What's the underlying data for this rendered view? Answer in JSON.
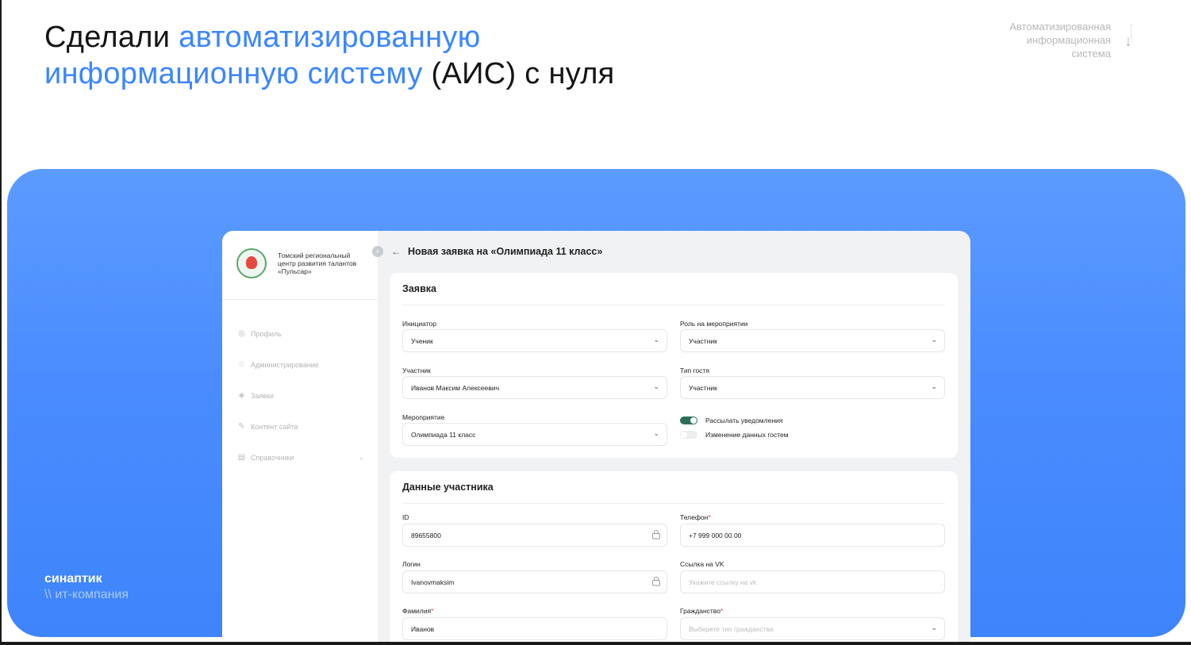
{
  "slide": {
    "headline_part1": "Сделали ",
    "headline_blue1": "автоматизированную",
    "headline_blue2": "информационную систему",
    "headline_part2": " (АИС) с нуля",
    "corner_line1": "Автоматизированная",
    "corner_line2": "информационная",
    "corner_line3": "система",
    "corner_arrow_icon": "arrow-down-icon"
  },
  "brand": {
    "name": "синаптик",
    "tagline": "\\\\ ит-компания"
  },
  "colors": {
    "accent": "#3a86ff",
    "panel": "#4a8cff",
    "toggle_on": "#2b6f57",
    "required": "#e23b3b"
  },
  "app": {
    "org": {
      "line1": "Томский региональный",
      "line2": "центр развития талантов",
      "line3": "«Пульсар»"
    },
    "nav": [
      {
        "icon": "user-circle-icon",
        "label": "Профиль"
      },
      {
        "icon": "star-icon",
        "label": "Администрирование"
      },
      {
        "icon": "layers-icon",
        "label": "Заявки"
      },
      {
        "icon": "edit-icon",
        "label": "Контент сайта"
      },
      {
        "icon": "clipboard-icon",
        "label": "Справочники"
      }
    ],
    "page_title": "Новая заявка на «Олимпиада 11 класс»",
    "request_card": {
      "title": "Заявка",
      "initiator_label": "Инициатор",
      "initiator_value": "Ученик",
      "role_label": "Роль на мероприятии",
      "role_value": "Участник",
      "participant_label": "Участник",
      "participant_value": "Иванов Максим Алексеевич",
      "guest_type_label": "Тип гостя",
      "guest_type_value": "Участник",
      "event_label": "Мероприятие",
      "event_value": "Олимпиада 11 класс",
      "notify_label": "Рассылать уведомления",
      "notify_on": true,
      "guest_edit_label": "Изменение данных гостем",
      "guest_edit_on": false
    },
    "participant_card": {
      "title": "Данные участника",
      "id_label": "ID",
      "id_value": "89655800",
      "phone_label": "Телефон",
      "phone_value": "+7 999 000 00 00",
      "login_label": "Логин",
      "login_value": "Ivanovmaksim",
      "vk_label": "Ссылка на VK",
      "vk_placeholder": "Укажите ссылку на vk",
      "surname_label": "Фамилия",
      "surname_value": "Иванов",
      "citizenship_label": "Гражданство",
      "citizenship_placeholder": "Выберете тип гражданства",
      "required_mark": "*"
    }
  }
}
